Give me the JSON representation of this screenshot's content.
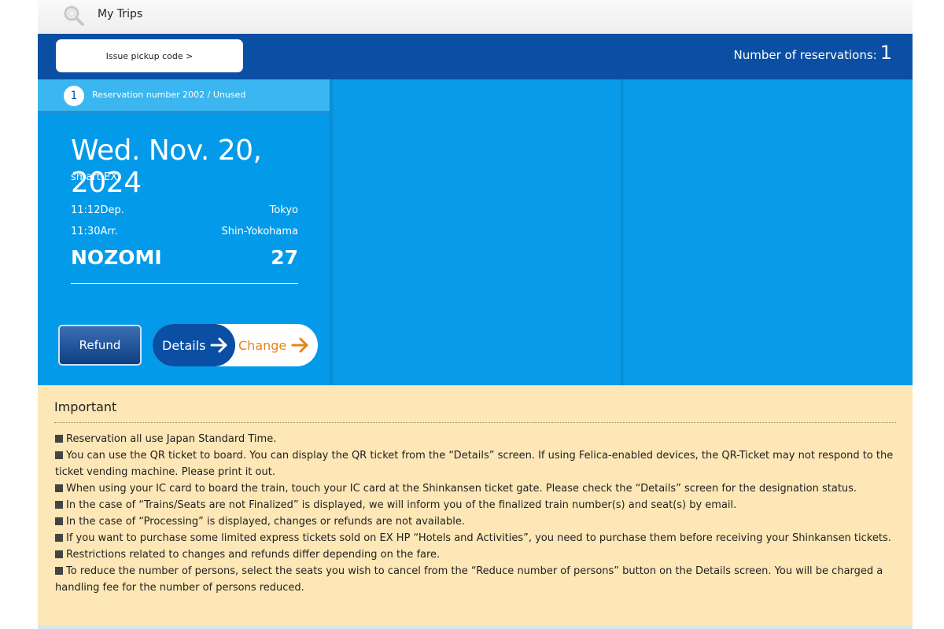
{
  "header": {
    "title": "My Trips",
    "search_icon": "search-icon"
  },
  "toolbar": {
    "pickup_label": "Issue pickup code  >",
    "reservations_label": "Number of reservations:",
    "reservations_count": "1"
  },
  "card": {
    "badge": "1",
    "reservation_text": "Reservation number 2002 / Unused",
    "date": "Wed. Nov. 20, 2024",
    "product": "smart EX",
    "dep_time": "11:12Dep.",
    "dep_station": "Tokyo",
    "arr_time": "11:30Arr.",
    "arr_station": "Shin-Yokohama",
    "train_name": "NOZOMI",
    "train_number": "27",
    "refund_label": "Refund",
    "details_label": "Details",
    "change_label": "Change",
    "arrow_icon": "arrow-right-icon"
  },
  "important": {
    "heading": "Important",
    "items": [
      "Reservation all use Japan Standard Time.",
      "You can use the QR ticket to board. You can display the QR ticket from the “Details” screen. If using Felica-enabled devices, the QR-Ticket may not respond to the ticket vending machine. Please print it out.",
      "When using your IC card to board the train, touch your IC card at the Shinkansen ticket gate. Please check the “Details” screen for the designation status.",
      "In the case of “Trains/Seats are not Finalized” is displayed, we will inform you of the finalized train number(s) and seat(s) by email.",
      "In the case of “Processing” is displayed, changes or refunds are not available.",
      "If you want to purchase some limited express tickets sold on EX HP “Hotels and Activities”, you need to purchase them before receiving your Shinkansen tickets.",
      "Restrictions related to changes and refunds differ depending on the fare.",
      "To reduce the number of persons, select the seats you wish to cancel from the “Reduce number of persons” button on the Details screen. You will be charged a handling fee for the number of persons reduced."
    ]
  },
  "colors": {
    "primary_dark": "#0a4fa3",
    "primary_light": "#0a9be8",
    "accent": "#e8831b",
    "notice_bg": "#fde7b7"
  }
}
